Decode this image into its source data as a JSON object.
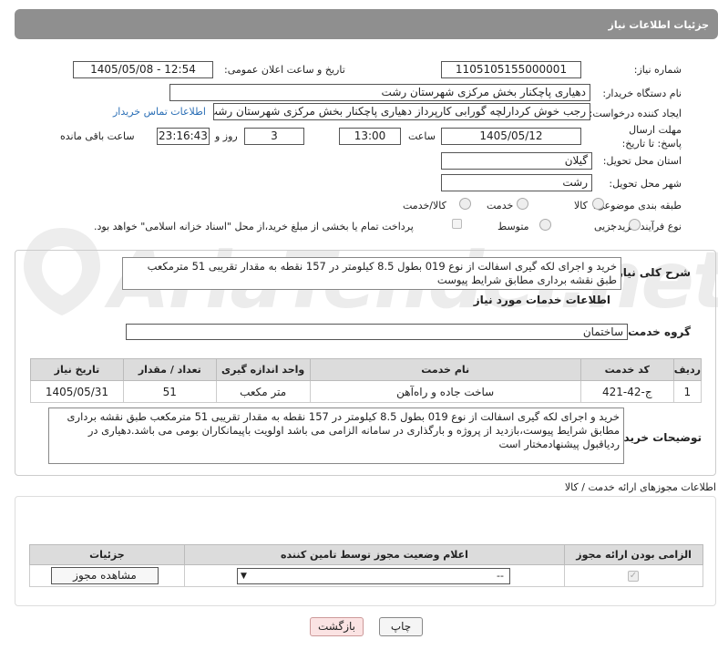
{
  "header": {
    "title": "جزئیات اطلاعات نیاز"
  },
  "watermark": {
    "text": "AriaTender.net"
  },
  "fields": {
    "need_number_label": "شماره نیاز:",
    "need_number": "1105105155000001",
    "announce_label": "تاریخ و ساعت اعلان عمومی:",
    "announce_value": "1405/05/08 - 12:54",
    "buyer_org_label": "نام دستگاه خریدار:",
    "buyer_org": "دهیاری پاچکنار بخش مرکزی شهرستان رشت",
    "creator_label": "ایجاد کننده درخواست:",
    "creator": "رجب خوش کردارلچه گورابی کارپرداز دهیاری پاچکنار بخش مرکزی شهرستان رشت",
    "contact_link": "اطلاعات تماس خریدار",
    "deadline_label": "مهلت ارسال پاسخ: تا تاریخ:",
    "deadline_date": "1405/05/12",
    "time_label": "ساعت",
    "deadline_time": "13:00",
    "days": "3",
    "days_label": "روز و",
    "remaining_time": "23:16:43",
    "remaining_label": "ساعت باقی مانده",
    "province_label": "استان محل تحویل:",
    "province": "گیلان",
    "city_label": "شهر محل تحویل:",
    "city": "رشت",
    "category_label": "طبقه بندی موضوعی:",
    "category_options": [
      "کالا",
      "خدمت",
      "کالا/خدمت"
    ],
    "process_label": "نوع فرآیند خرید :",
    "process_options": [
      "جزیی",
      "متوسط"
    ],
    "payment_note": "پرداخت تمام یا بخشی از مبلغ خرید،از محل \"اسناد خزانه اسلامی\" خواهد بود."
  },
  "summary": {
    "label": "شرح کلی نیاز:",
    "text": "خرید و اجرای لکه گیری اسفالت از نوع 019 بطول 8.5 کیلومتر در 157 نقطه به مقدار تقریبی 51 مترمکعب طبق نقشه برداری مطابق شرایط پیوست"
  },
  "services": {
    "title": "اطلاعات خدمات مورد نیاز",
    "group_label": "گروه خدمت:",
    "group_value": "ساختمان",
    "columns": [
      "ردیف",
      "کد خدمت",
      "نام خدمت",
      "واحد اندازه گیری",
      "تعداد / مقدار",
      "تاریخ نیاز"
    ],
    "rows": [
      {
        "row": "1",
        "code": "ج-42-421",
        "name": "ساخت جاده و راه‌آهن",
        "unit": "متر مکعب",
        "qty": "51",
        "date": "1405/05/31"
      }
    ]
  },
  "buyer_notes": {
    "label": "توضیحات خریدار:",
    "text": "خرید و اجرای لکه گیری اسفالت از نوع 019 بطول 8.5 کیلومتر در 157 نقطه به مقدار تقریبی 51 مترمکعب طبق نقشه برداری مطابق شرایط پیوست،بازدید از پروژه و بارگذاری در سامانه الزامی می باشد اولویت باپیمانکاران بومی می باشد.دهیاری در ردیاقبول پیشنهادمختار است"
  },
  "permits": {
    "title": "اطلاعات مجوزهای ارائه خدمت / کالا",
    "columns": [
      "الزامی بودن ارائه مجوز",
      "اعلام وضعیت مجوز توسط تامین کننده",
      "جزئیات"
    ],
    "select_value": "--",
    "view_button": "مشاهده مجوز"
  },
  "footer": {
    "print": "چاپ",
    "back": "بازگشت"
  }
}
